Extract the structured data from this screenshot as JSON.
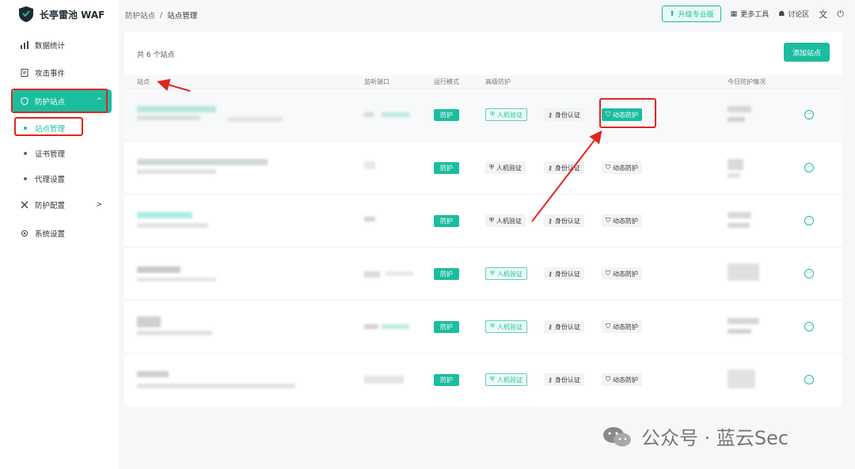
{
  "app": {
    "name": "长亭雷池 WAF"
  },
  "sidebar": {
    "items": [
      {
        "label": "数据统计"
      },
      {
        "label": "攻击事件"
      },
      {
        "label": "防护站点",
        "chevron": "^"
      },
      {
        "label": "防护配置",
        "chevron": ">"
      },
      {
        "label": "系统设置"
      }
    ],
    "sub_items": [
      {
        "label": "站点管理"
      },
      {
        "label": "证书管理"
      },
      {
        "label": "代理设置"
      }
    ]
  },
  "breadcrumb": {
    "parent": "防护站点",
    "separator": "/",
    "current": "站点管理"
  },
  "topbar": {
    "upgrade_label": "升级专业版",
    "more_tools_label": "更多工具",
    "forum_label": "讨论区"
  },
  "card": {
    "count_text": "共 6 个站点",
    "add_button_label": "添加站点",
    "columns": [
      "站点",
      "监听端口",
      "运行模式",
      "高级防护",
      "今日防护情况"
    ]
  },
  "rows": [
    {
      "mode": "防护",
      "tags": [
        "人机验证",
        "身份认证",
        "动态防护"
      ],
      "states": [
        "outline",
        "plain",
        "filled"
      ]
    },
    {
      "mode": "防护",
      "tags": [
        "人机验证",
        "身份认证",
        "动态防护"
      ],
      "states": [
        "plain",
        "plain",
        "plain"
      ]
    },
    {
      "mode": "防护",
      "tags": [
        "人机验证",
        "身份认证",
        "动态防护"
      ],
      "states": [
        "plain",
        "plain",
        "plain"
      ]
    },
    {
      "mode": "防护",
      "tags": [
        "人机验证",
        "身份认证",
        "动态防护"
      ],
      "states": [
        "outline",
        "plain",
        "plain"
      ]
    },
    {
      "mode": "防护",
      "tags": [
        "人机验证",
        "身份认证",
        "动态防护"
      ],
      "states": [
        "outline",
        "plain",
        "plain"
      ]
    },
    {
      "mode": "防护",
      "tags": [
        "人机验证",
        "身份认证",
        "动态防护"
      ],
      "states": [
        "outline",
        "plain",
        "plain"
      ]
    }
  ],
  "watermark": {
    "text": "公众号 · 蓝云Sec"
  },
  "colors": {
    "accent": "#1bbd9f",
    "highlight": "#e0261d"
  }
}
